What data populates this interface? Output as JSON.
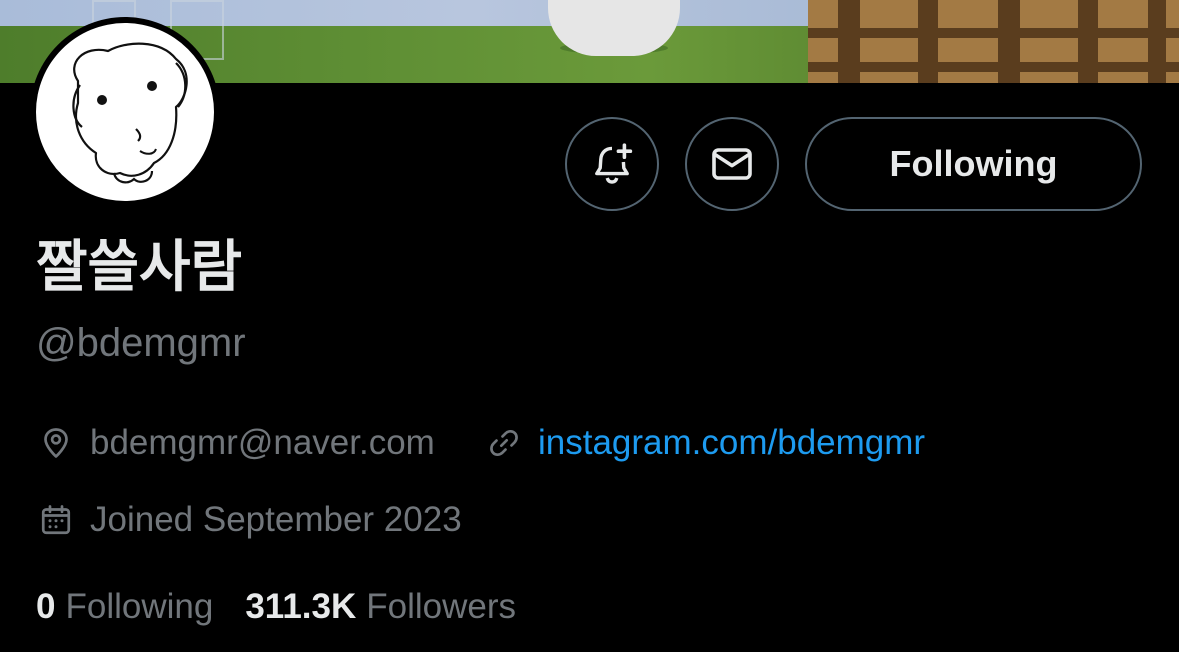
{
  "profile": {
    "display_name": "짤쓸사람",
    "handle": "@bdemgmr",
    "location": "bdemgmr@naver.com",
    "website": "instagram.com/bdemgmr",
    "joined": "Joined September 2023"
  },
  "actions": {
    "notify_icon": "bell-plus-icon",
    "message_icon": "mail-icon",
    "follow_label": "Following"
  },
  "stats": {
    "following_count": "0",
    "following_label": "Following",
    "followers_count": "311.3K",
    "followers_label": "Followers"
  },
  "colors": {
    "background": "#000000",
    "primary_text": "#e7e9ea",
    "secondary_text": "#71767b",
    "link": "#1d9bf0",
    "border": "#536471"
  },
  "icons": {
    "location": "location-pin-icon",
    "website": "link-icon",
    "joined": "calendar-icon"
  }
}
